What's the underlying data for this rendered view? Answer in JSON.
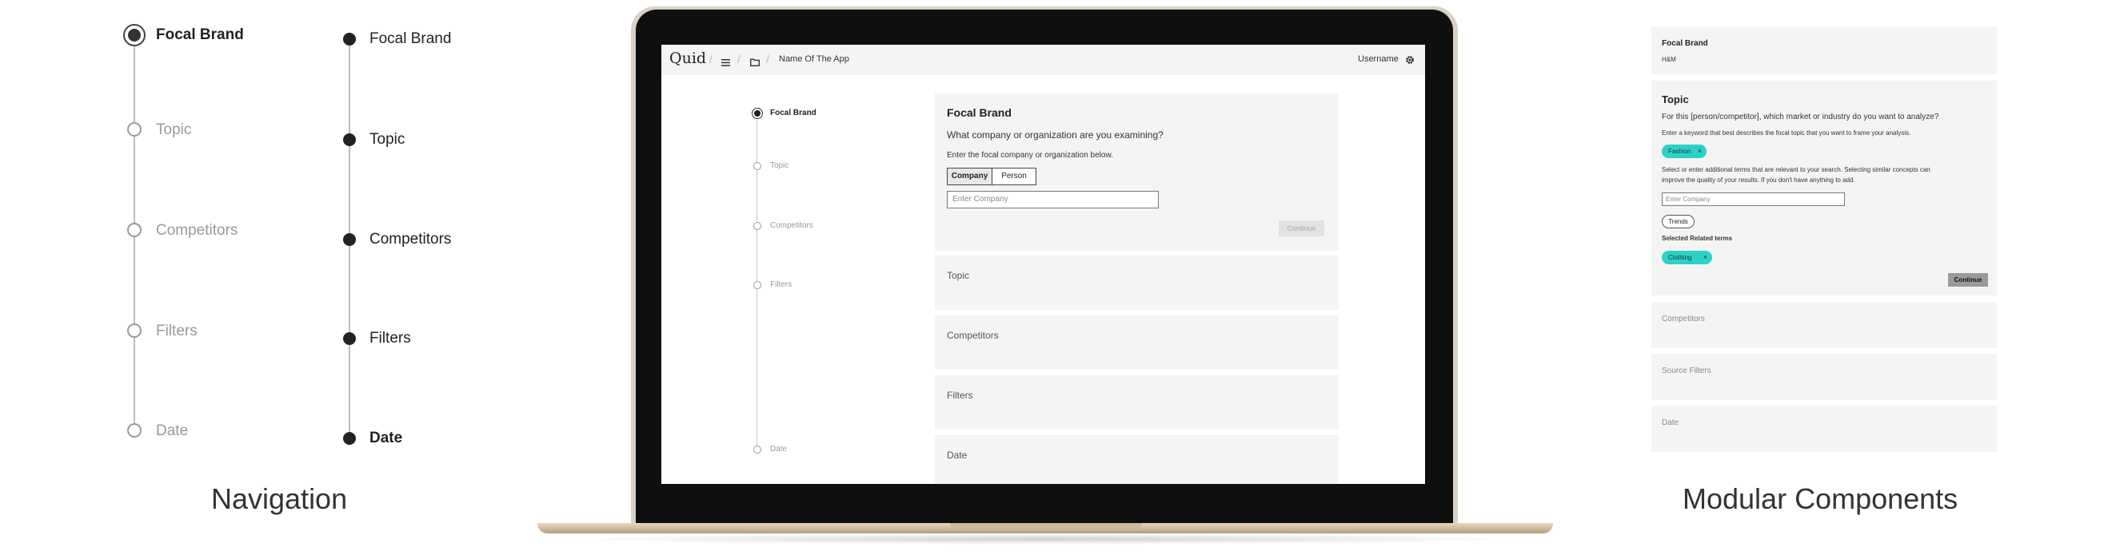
{
  "navigation": {
    "title": "Navigation",
    "steps_light": [
      {
        "label": "Focal Brand",
        "active": true
      },
      {
        "label": "Topic",
        "active": false
      },
      {
        "label": "Competitors",
        "active": false
      },
      {
        "label": "Filters",
        "active": false
      },
      {
        "label": "Date",
        "active": false
      }
    ],
    "steps_dark": [
      {
        "label": "Focal Brand"
      },
      {
        "label": "Topic"
      },
      {
        "label": "Competitors"
      },
      {
        "label": "Filters"
      },
      {
        "label": "Date"
      }
    ]
  },
  "app": {
    "logo": "Quid",
    "separator": "/",
    "app_name": "Name Of The App",
    "username": "Username",
    "menu_icon": "hamburger-menu-icon",
    "folder_icon": "folder-icon",
    "settings_icon": "gear-icon",
    "steps": [
      "Focal Brand",
      "Topic",
      "Competitors",
      "Filters",
      "Date"
    ],
    "focal_card": {
      "title": "Focal Brand",
      "question": "What company or organization are you examining?",
      "instruction": "Enter the focal company or organization below.",
      "toggle_options": [
        "Company",
        "Person"
      ],
      "input_placeholder": "Enter Company",
      "continue_label": "Continue"
    },
    "collapsed_cards": [
      "Topic",
      "Competitors",
      "Filters",
      "Date"
    ]
  },
  "modules": {
    "title": "Modular Components",
    "focal": {
      "title": "Focal Brand",
      "value": "H&M"
    },
    "topic": {
      "title": "Topic",
      "question": "For this [person/competitor], which market or industry do you want to analyze?",
      "instruction": "Enter a keyword that best describes the focal topic that you want to frame your analysis.",
      "keyword_chip": "Fashion",
      "related_instruction_1": "Select or enter additional terms that are relevant to your search. Selecting similar concepts can",
      "related_instruction_2": "improve the quality of your results. If you don't have anything to add.",
      "input_placeholder": "Enter Company",
      "suggestion": "Trends",
      "selected_heading": "Selected Related terms",
      "selected_chip": "Clothing",
      "chip_remove": "×",
      "continue_label": "Continue"
    },
    "collapsed": [
      "Competitors",
      "Source Filters",
      "Date"
    ]
  }
}
